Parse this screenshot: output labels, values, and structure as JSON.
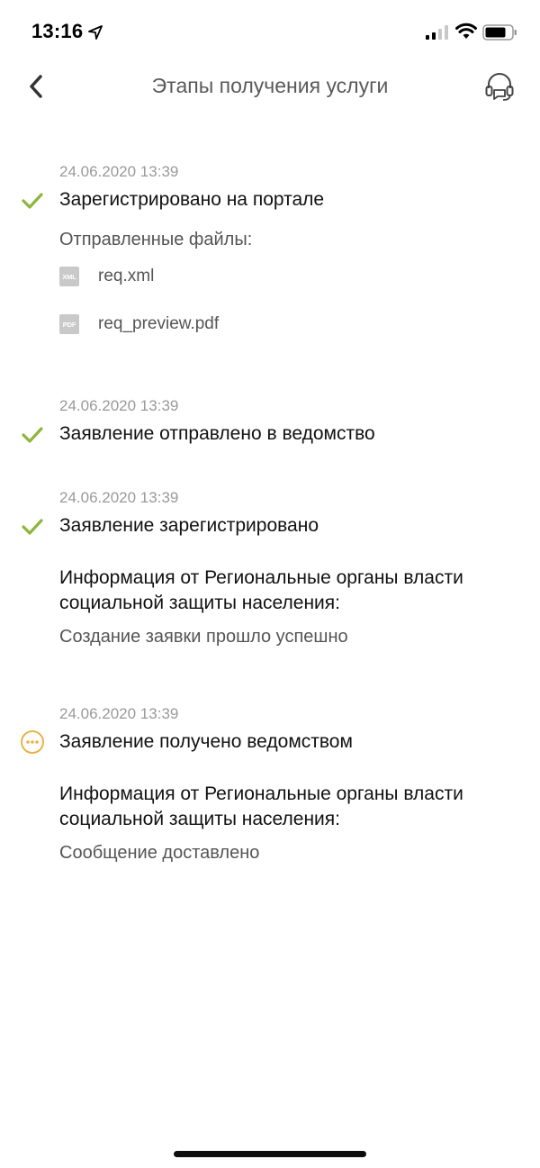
{
  "status_bar": {
    "time": "13:16"
  },
  "nav": {
    "title": "Этапы получения услуги"
  },
  "steps": [
    {
      "date": "24.06.2020 13:39",
      "title": "Зарегистрировано на портале",
      "status": "done",
      "files_label": "Отправленные файлы:",
      "files": [
        {
          "type": "XML",
          "name": "req.xml"
        },
        {
          "type": "PDF",
          "name": "req_preview.pdf"
        }
      ]
    },
    {
      "date": "24.06.2020 13:39",
      "title": "Заявление отправлено в ведомство",
      "status": "done"
    },
    {
      "date": "24.06.2020 13:39",
      "title": "Заявление зарегистрировано",
      "status": "done",
      "info_heading": "Информация от Региональные органы власти социальной защиты населения:",
      "info_message": "Создание заявки прошло успешно"
    },
    {
      "date": "24.06.2020 13:39",
      "title": "Заявление получено ведомством",
      "status": "in-progress",
      "info_heading": "Информация от Региональные органы власти социальной защиты населения:",
      "info_message": "Сообщение доставлено"
    }
  ],
  "colors": {
    "done": "#8cb63c",
    "in_progress": "#e8b34a",
    "muted_text": "#9a9a9a"
  }
}
